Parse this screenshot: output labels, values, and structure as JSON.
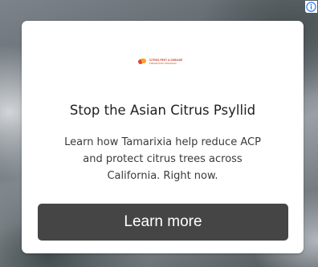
{
  "ad": {
    "logo": {
      "line1": "CITRUS PEST & DISEASE",
      "line2": "PREVENTION PROGRAM"
    },
    "headline": "Stop the Asian Citrus Psyllid",
    "body_lines": [
      "Learn how Tamarixia help reduce ACP",
      "and protect citrus trees across",
      "California. Right now."
    ],
    "cta_label": "Learn more",
    "adchoices_icon": "info-icon"
  },
  "colors": {
    "button": "#454545",
    "button_text": "#ffffff",
    "adchoices": "#1a73e8",
    "logo_primary": "#e8432c",
    "logo_secondary": "#f6a623"
  }
}
